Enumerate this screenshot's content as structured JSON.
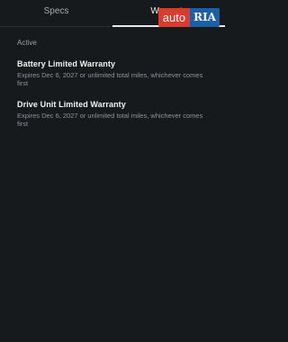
{
  "tabs": [
    {
      "label": "Specs",
      "active": false
    },
    {
      "label": "Warranty",
      "active": true
    }
  ],
  "watermark": {
    "left": "auto",
    "right": "RIA"
  },
  "section": {
    "label": "Active"
  },
  "warranties": [
    {
      "title": "Battery Limited Warranty",
      "subtitle": "Expires Dec 6, 2027 or unlimited total miles, whichever comes first"
    },
    {
      "title": "Drive Unit Limited Warranty",
      "subtitle": "Expires Dec 6, 2027 or unlimited total miles, whichever comes first"
    }
  ],
  "colors": {
    "background": "#171a1c",
    "active_tab_underline": "#e6e8ea",
    "watermark_red": "#db3a2f",
    "watermark_blue": "#1d5fa6"
  }
}
